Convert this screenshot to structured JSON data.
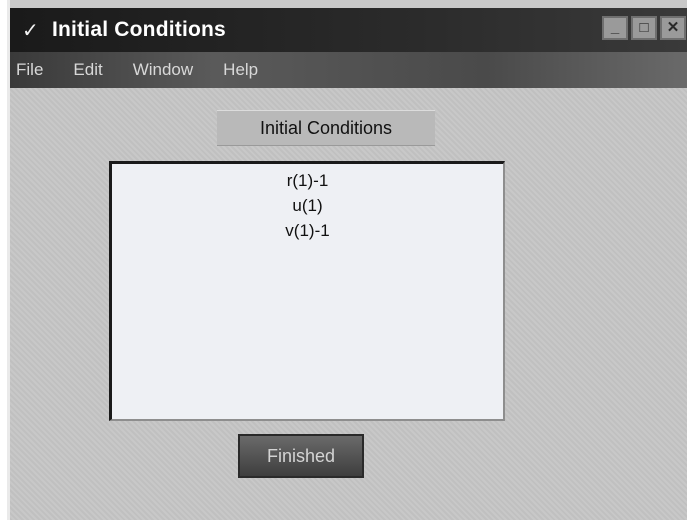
{
  "window": {
    "title": "Initial Conditions",
    "title_icon": "check-icon",
    "controls": [
      "minimize-icon",
      "maximize-icon",
      "close-icon"
    ]
  },
  "menubar": {
    "items": [
      "File",
      "Edit",
      "Window",
      "Help"
    ]
  },
  "main": {
    "label": "Initial Conditions",
    "list_items": [
      "r(1)-1",
      "u(1)",
      "v(1)-1"
    ],
    "button_label": "Finished"
  }
}
